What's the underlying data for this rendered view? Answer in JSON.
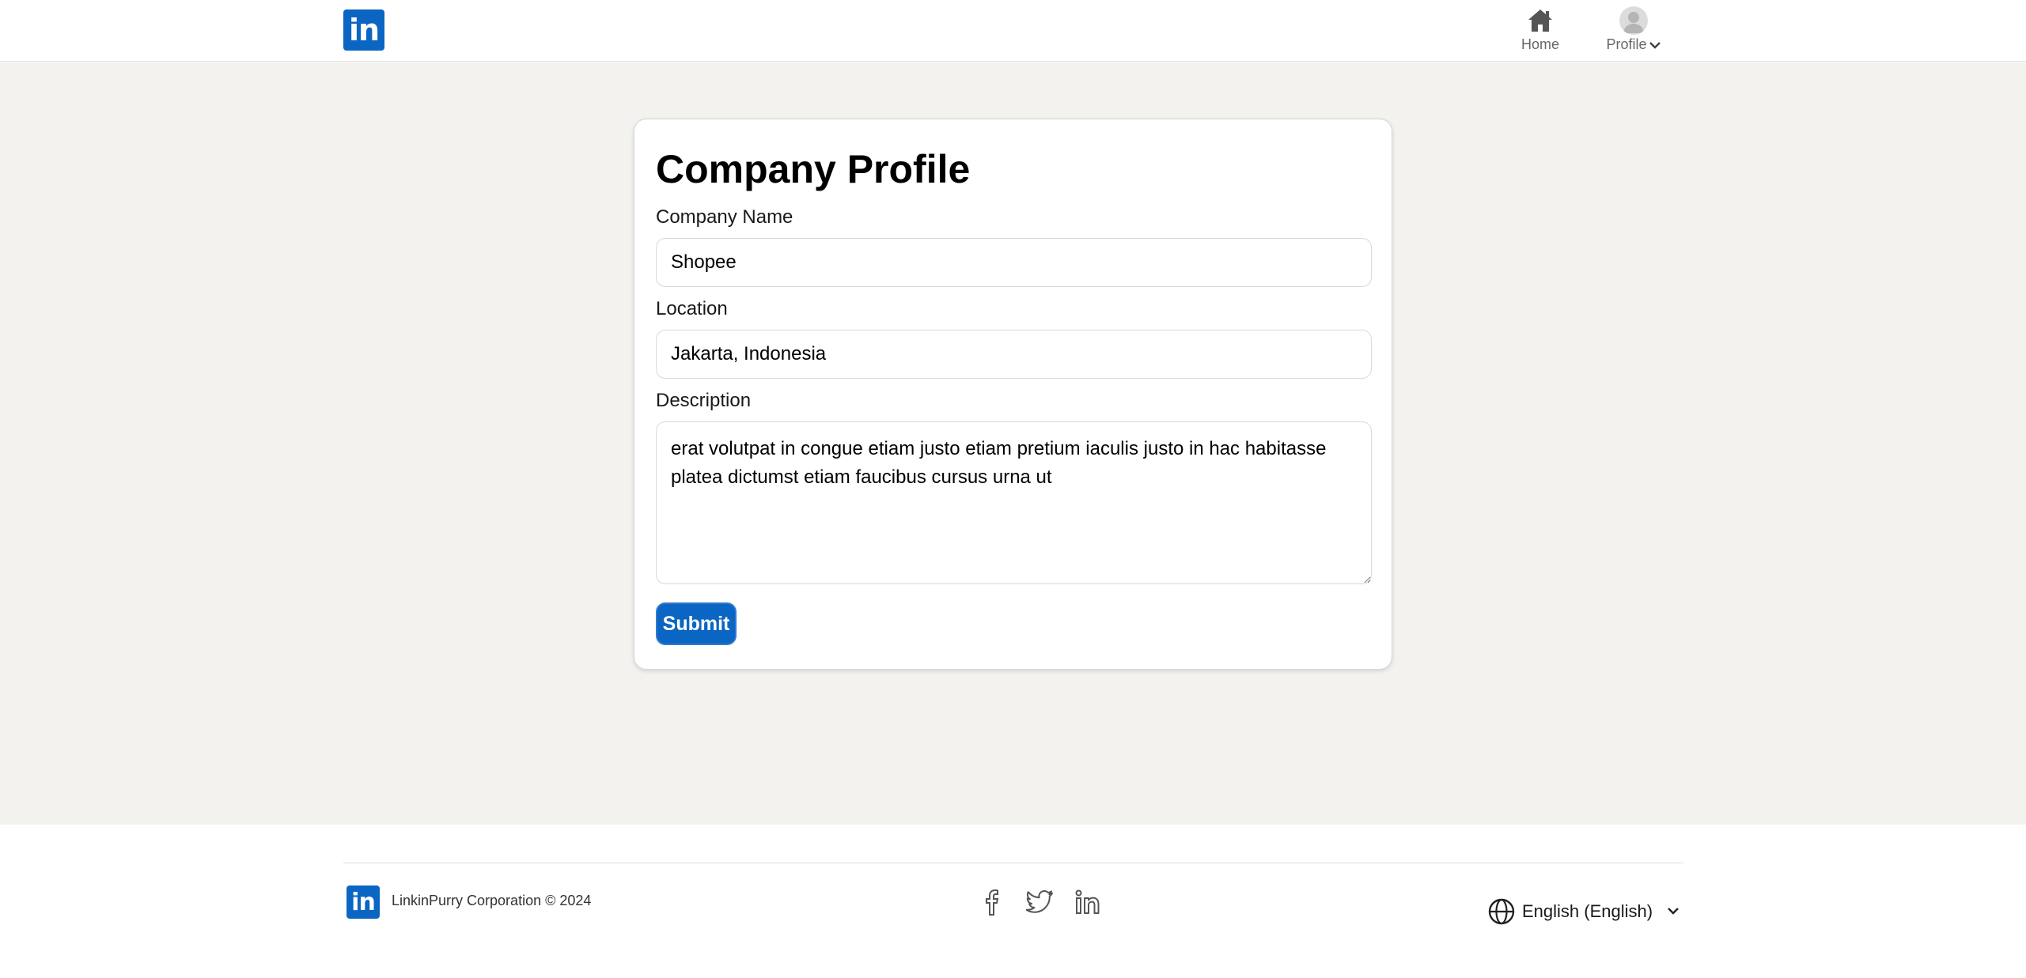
{
  "header": {
    "logo_text": "in",
    "nav": {
      "home_label": "Home",
      "profile_label": "Profile"
    }
  },
  "form": {
    "title": "Company Profile",
    "company_name_label": "Company Name",
    "company_name_value": "Shopee",
    "location_label": "Location",
    "location_value": "Jakarta, Indonesia",
    "description_label": "Description",
    "description_value": "erat volutpat in congue etiam justo etiam pretium iaculis justo in hac habitasse platea dictumst etiam faucibus cursus urna ut",
    "submit_label": "Submit"
  },
  "footer": {
    "logo_text": "in",
    "copyright": "LinkinPurry Corporation © 2024",
    "social_icons": [
      "facebook-icon",
      "twitter-icon",
      "linkedin-icon"
    ],
    "language": "English (English)"
  },
  "colors": {
    "brand": "#0a66c2",
    "page_background": "#f3f2ef",
    "muted_text": "#666666"
  }
}
